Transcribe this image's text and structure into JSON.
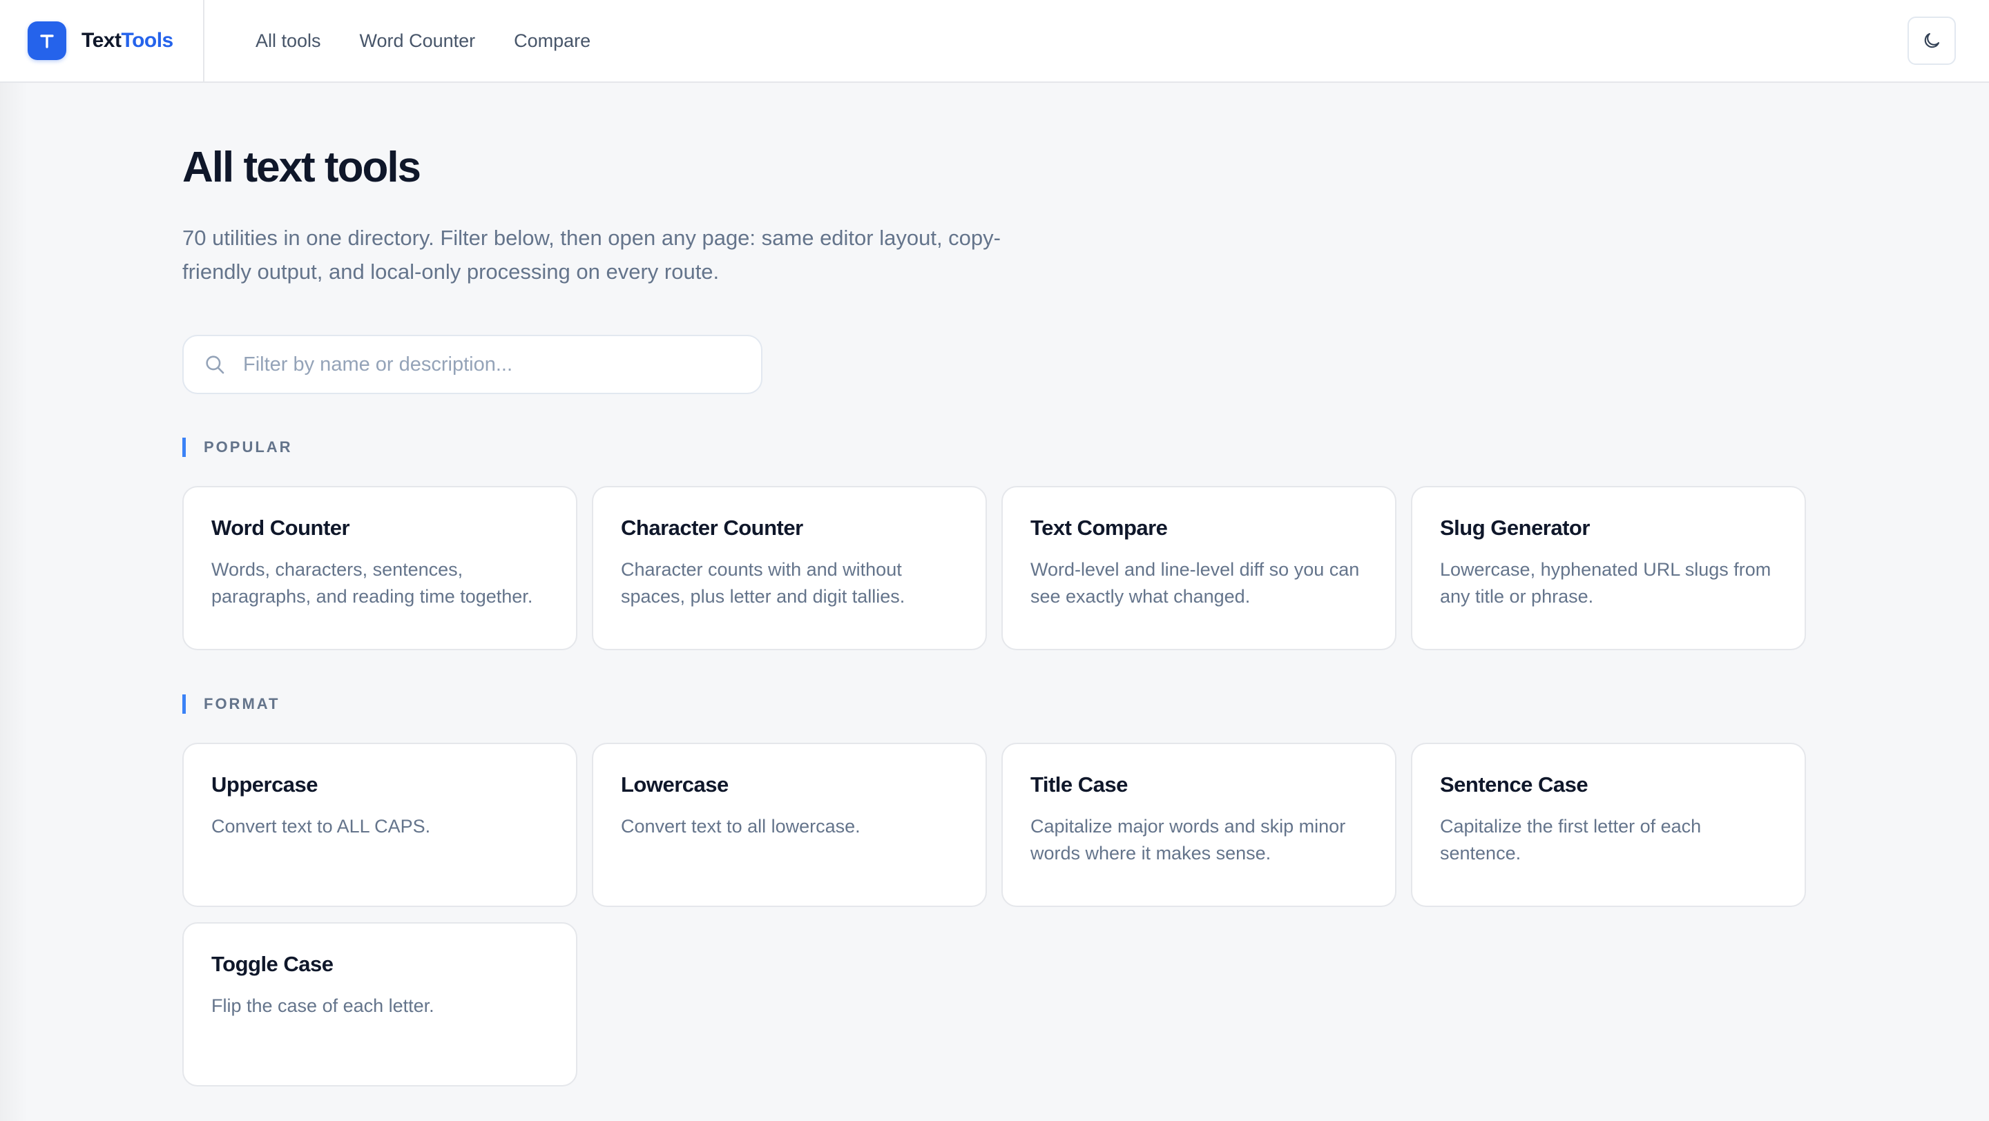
{
  "brand": {
    "name_part1": "Text",
    "name_part2": "Tools",
    "logo_letter": "T",
    "accent_color": "#2563eb"
  },
  "nav": {
    "items": [
      {
        "label": "All tools"
      },
      {
        "label": "Word Counter"
      },
      {
        "label": "Compare"
      }
    ]
  },
  "header": {
    "theme_toggle_icon": "moon-icon"
  },
  "main": {
    "title": "All text tools",
    "description": "70 utilities in one directory. Filter below, then open any page: same editor layout, copy-friendly output, and local-only processing on every route.",
    "search": {
      "placeholder": "Filter by name or description...",
      "value": "",
      "icon": "search-icon"
    },
    "sections": [
      {
        "label": "POPULAR",
        "tools": [
          {
            "title": "Word Counter",
            "description": "Words, characters, sentences, paragraphs, and reading time together."
          },
          {
            "title": "Character Counter",
            "description": "Character counts with and without spaces, plus letter and digit tallies."
          },
          {
            "title": "Text Compare",
            "description": "Word-level and line-level diff so you can see exactly what changed."
          },
          {
            "title": "Slug Generator",
            "description": "Lowercase, hyphenated URL slugs from any title or phrase."
          }
        ]
      },
      {
        "label": "FORMAT",
        "tools": [
          {
            "title": "Uppercase",
            "description": "Convert text to ALL CAPS."
          },
          {
            "title": "Lowercase",
            "description": "Convert text to all lowercase."
          },
          {
            "title": "Title Case",
            "description": "Capitalize major words and skip minor words where it makes sense."
          },
          {
            "title": "Sentence Case",
            "description": "Capitalize the first letter of each sentence."
          },
          {
            "title": "Toggle Case",
            "description": "Flip the case of each letter."
          }
        ]
      }
    ]
  }
}
